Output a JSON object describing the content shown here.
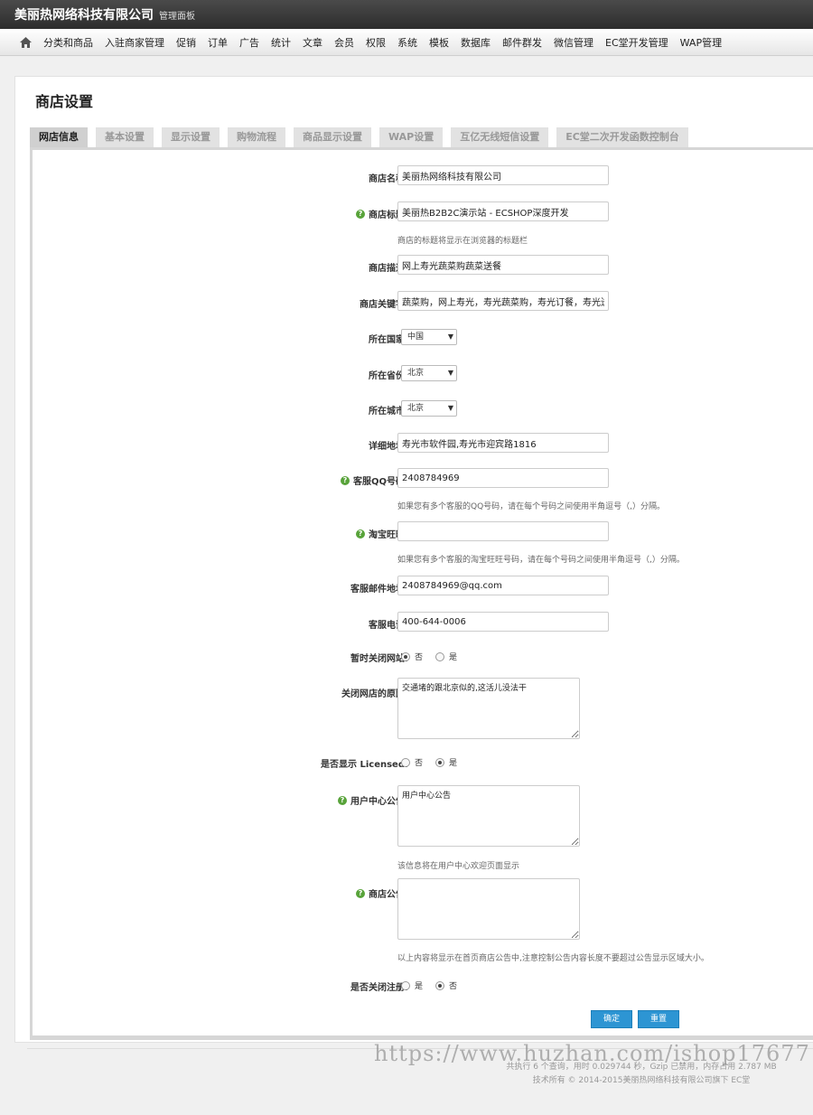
{
  "header": {
    "brand": "美丽热网络科技有限公司",
    "subtitle": "管理面板"
  },
  "nav": {
    "home_icon": "home-icon",
    "items": [
      "分类和商品",
      "入驻商家管理",
      "促销",
      "订单",
      "广告",
      "统计",
      "文章",
      "会员",
      "权限",
      "系统",
      "模板",
      "数据库",
      "邮件群发",
      "微信管理",
      "EC堂开发管理",
      "WAP管理"
    ]
  },
  "page": {
    "title": "商店设置"
  },
  "tabs": [
    "网店信息",
    "基本设置",
    "显示设置",
    "购物流程",
    "商品显示设置",
    "WAP设置",
    "互亿无线短信设置",
    "EC堂二次开发函数控制台"
  ],
  "form": {
    "shop_name": {
      "label": "商店名称:",
      "value": "美丽热网络科技有限公司"
    },
    "shop_title": {
      "label": "商店标题:",
      "value": "美丽热B2B2C演示站 - ECSHOP深度开发",
      "note": "商店的标题将显示在浏览器的标题栏"
    },
    "shop_desc": {
      "label": "商店描述:",
      "value": "网上寿光蔬菜购蔬菜送餐"
    },
    "shop_keywords": {
      "label": "商店关键字:",
      "value": "蔬菜购，网上寿光，寿光蔬菜购，寿光订餐，寿光送餐，"
    },
    "country": {
      "label": "所在国家:",
      "value": "中国"
    },
    "province": {
      "label": "所在省份:",
      "value": "北京"
    },
    "city": {
      "label": "所在城市:",
      "value": "北京"
    },
    "address": {
      "label": "详细地址:",
      "value": "寿光市软件园,寿光市迎宾路1816"
    },
    "qq": {
      "label": "客服QQ号码:",
      "value": "2408784969",
      "note": "如果您有多个客服的QQ号码，请在每个号码之间使用半角逗号（,）分隔。"
    },
    "wangwang": {
      "label": "淘宝旺旺:",
      "value": "",
      "note": "如果您有多个客服的淘宝旺旺号码，请在每个号码之间使用半角逗号（,）分隔。"
    },
    "email": {
      "label": "客服邮件地址:",
      "value": "2408784969@qq.com"
    },
    "phone": {
      "label": "客服电话:",
      "value": "400-644-0006"
    },
    "closed": {
      "label": "暂时关闭网站:",
      "opt1": "否",
      "opt2": "是"
    },
    "close_reason": {
      "label": "关闭网店的原因:",
      "value": "交通堵的跟北京似的,这活儿没法干"
    },
    "licensed": {
      "label": "是否显示 Licensed:",
      "opt1": "否",
      "opt2": "是"
    },
    "user_notice": {
      "label": "用户中心公告:",
      "value": "用户中心公告",
      "note": "该信息将在用户中心欢迎页面显示"
    },
    "shop_notice": {
      "label": "商店公告:",
      "value": "",
      "note": "以上内容将显示在首页商店公告中,注意控制公告内容长度不要超过公告显示区域大小。"
    },
    "close_register": {
      "label": "是否关闭注册:",
      "opt1": "是",
      "opt2": "否"
    }
  },
  "buttons": {
    "confirm": "确定",
    "reset": "重置"
  },
  "footer": {
    "line1": "共执行 6 个查询，用时 0.029744 秒，Gzip 已禁用，内存占用 2.787 MB",
    "line2": "技术所有 © 2014-2015美丽热网络科技有限公司旗下 EC堂"
  },
  "watermark": "https://www.huzhan.com/ishop17677",
  "colors": {
    "accent": "#2d95d3",
    "help": "#58a33a",
    "topbar": "#333333"
  }
}
